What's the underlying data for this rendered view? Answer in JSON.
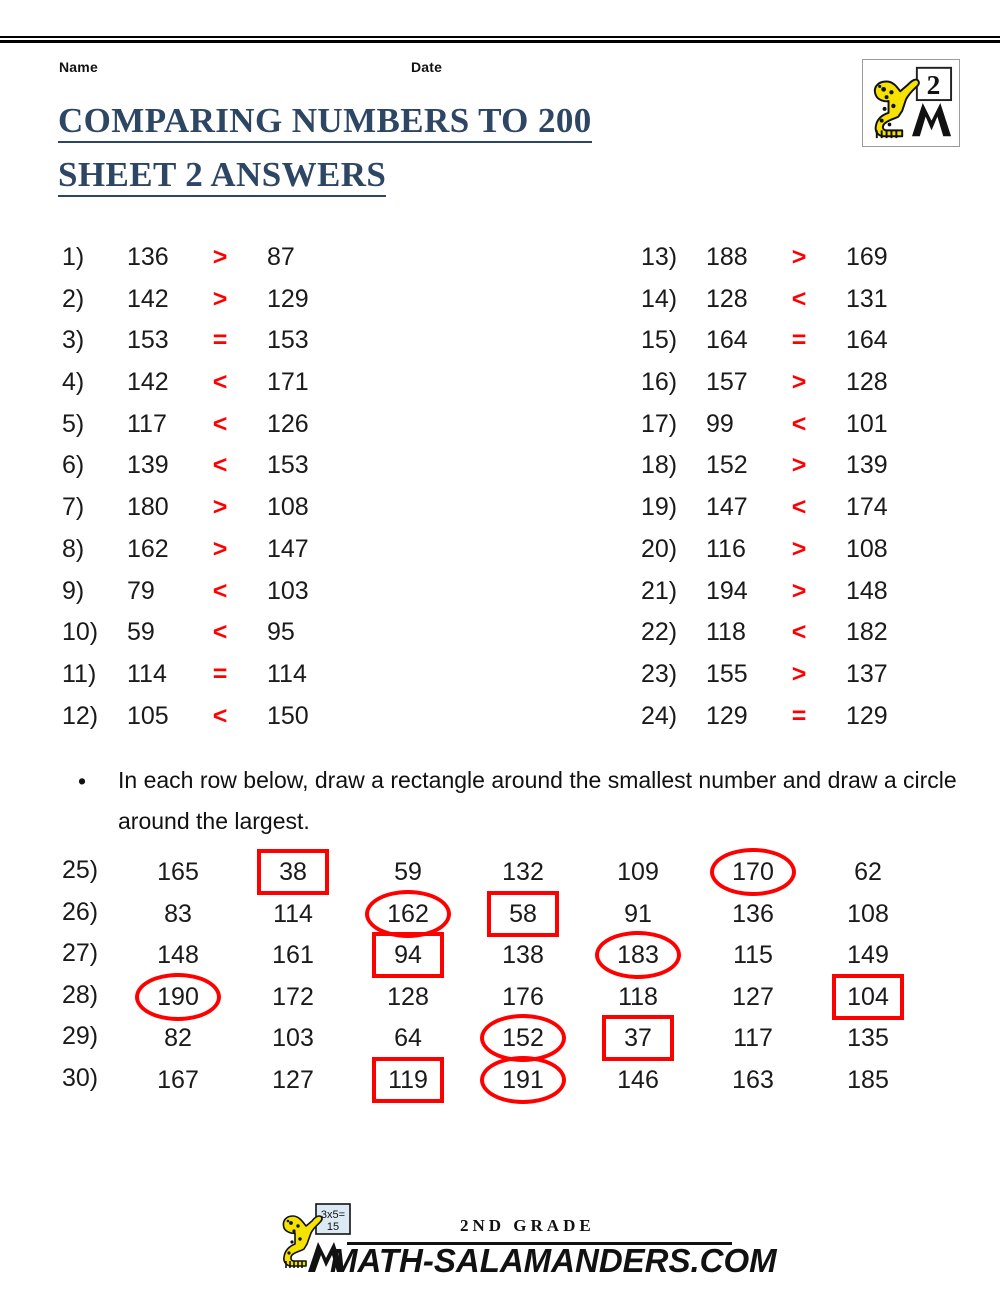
{
  "header": {
    "name_label": "Name",
    "date_label": "Date",
    "title_line1": "COMPARING NUMBERS TO 200",
    "title_line2": "SHEET 2 ANSWERS",
    "logo_badge_number": "2",
    "accent_color": "#2d4663",
    "answer_color": "#ff0000"
  },
  "comparisons": {
    "left": [
      {
        "index": "1)",
        "a": "136",
        "op": ">",
        "b": "87"
      },
      {
        "index": "2)",
        "a": "142",
        "op": ">",
        "b": "129"
      },
      {
        "index": "3)",
        "a": "153",
        "op": "=",
        "b": "153"
      },
      {
        "index": "4)",
        "a": "142",
        "op": "<",
        "b": "171"
      },
      {
        "index": "5)",
        "a": "117",
        "op": "<",
        "b": "126"
      },
      {
        "index": "6)",
        "a": "139",
        "op": "<",
        "b": "153"
      },
      {
        "index": "7)",
        "a": "180",
        "op": ">",
        "b": "108"
      },
      {
        "index": "8)",
        "a": "162",
        "op": ">",
        "b": "147"
      },
      {
        "index": "9)",
        "a": "79",
        "op": "<",
        "b": "103"
      },
      {
        "index": "10)",
        "a": "59",
        "op": "<",
        "b": "95"
      },
      {
        "index": "11)",
        "a": "114",
        "op": "=",
        "b": "114"
      },
      {
        "index": "12)",
        "a": "105",
        "op": "<",
        "b": "150"
      }
    ],
    "right": [
      {
        "index": "13)",
        "a": "188",
        "op": ">",
        "b": "169"
      },
      {
        "index": "14)",
        "a": "128",
        "op": "<",
        "b": "131"
      },
      {
        "index": "15)",
        "a": "164",
        "op": "=",
        "b": "164"
      },
      {
        "index": "16)",
        "a": "157",
        "op": ">",
        "b": "128"
      },
      {
        "index": "17)",
        "a": "99",
        "op": "<",
        "b": "101"
      },
      {
        "index": "18)",
        "a": "152",
        "op": ">",
        "b": "139"
      },
      {
        "index": "19)",
        "a": "147",
        "op": "<",
        "b": "174"
      },
      {
        "index": "20)",
        "a": "116",
        "op": ">",
        "b": "108"
      },
      {
        "index": "21)",
        "a": "194",
        "op": ">",
        "b": "148"
      },
      {
        "index": "22)",
        "a": "118",
        "op": "<",
        "b": "182"
      },
      {
        "index": "23)",
        "a": "155",
        "op": ">",
        "b": "137"
      },
      {
        "index": "24)",
        "a": "129",
        "op": "=",
        "b": "129"
      }
    ]
  },
  "instruction": {
    "bullet": "•",
    "text": "In each row below, draw a rectangle around the smallest number and draw a circle around the largest."
  },
  "number_rows": [
    {
      "index": "25)",
      "cells": [
        {
          "value": "165",
          "mark": "none"
        },
        {
          "value": "38",
          "mark": "rect"
        },
        {
          "value": "59",
          "mark": "none"
        },
        {
          "value": "132",
          "mark": "none"
        },
        {
          "value": "109",
          "mark": "none"
        },
        {
          "value": "170",
          "mark": "circle"
        },
        {
          "value": "62",
          "mark": "none"
        }
      ]
    },
    {
      "index": "26)",
      "cells": [
        {
          "value": "83",
          "mark": "none"
        },
        {
          "value": "114",
          "mark": "none"
        },
        {
          "value": "162",
          "mark": "circle"
        },
        {
          "value": "58",
          "mark": "rect"
        },
        {
          "value": "91",
          "mark": "none"
        },
        {
          "value": "136",
          "mark": "none"
        },
        {
          "value": "108",
          "mark": "none"
        }
      ]
    },
    {
      "index": "27)",
      "cells": [
        {
          "value": "148",
          "mark": "none"
        },
        {
          "value": "161",
          "mark": "none"
        },
        {
          "value": "94",
          "mark": "rect"
        },
        {
          "value": "138",
          "mark": "none"
        },
        {
          "value": "183",
          "mark": "circle"
        },
        {
          "value": "115",
          "mark": "none"
        },
        {
          "value": "149",
          "mark": "none"
        }
      ]
    },
    {
      "index": "28)",
      "cells": [
        {
          "value": "190",
          "mark": "circle"
        },
        {
          "value": "172",
          "mark": "none"
        },
        {
          "value": "128",
          "mark": "none"
        },
        {
          "value": "176",
          "mark": "none"
        },
        {
          "value": "118",
          "mark": "none"
        },
        {
          "value": "127",
          "mark": "none"
        },
        {
          "value": "104",
          "mark": "rect"
        }
      ]
    },
    {
      "index": "29)",
      "cells": [
        {
          "value": "82",
          "mark": "none"
        },
        {
          "value": "103",
          "mark": "none"
        },
        {
          "value": "64",
          "mark": "none"
        },
        {
          "value": "152",
          "mark": "circle"
        },
        {
          "value": "37",
          "mark": "rect"
        },
        {
          "value": "117",
          "mark": "none"
        },
        {
          "value": "135",
          "mark": "none"
        }
      ]
    },
    {
      "index": "30)",
      "cells": [
        {
          "value": "167",
          "mark": "none"
        },
        {
          "value": "127",
          "mark": "none"
        },
        {
          "value": "119",
          "mark": "rect"
        },
        {
          "value": "191",
          "mark": "circle"
        },
        {
          "value": "146",
          "mark": "none"
        },
        {
          "value": "163",
          "mark": "none"
        },
        {
          "value": "185",
          "mark": "none"
        }
      ]
    }
  ],
  "footer": {
    "grade": "2ND GRADE",
    "site": "MATH-SALAMANDERS.COM",
    "logo_board_text": "3x5= 15"
  }
}
